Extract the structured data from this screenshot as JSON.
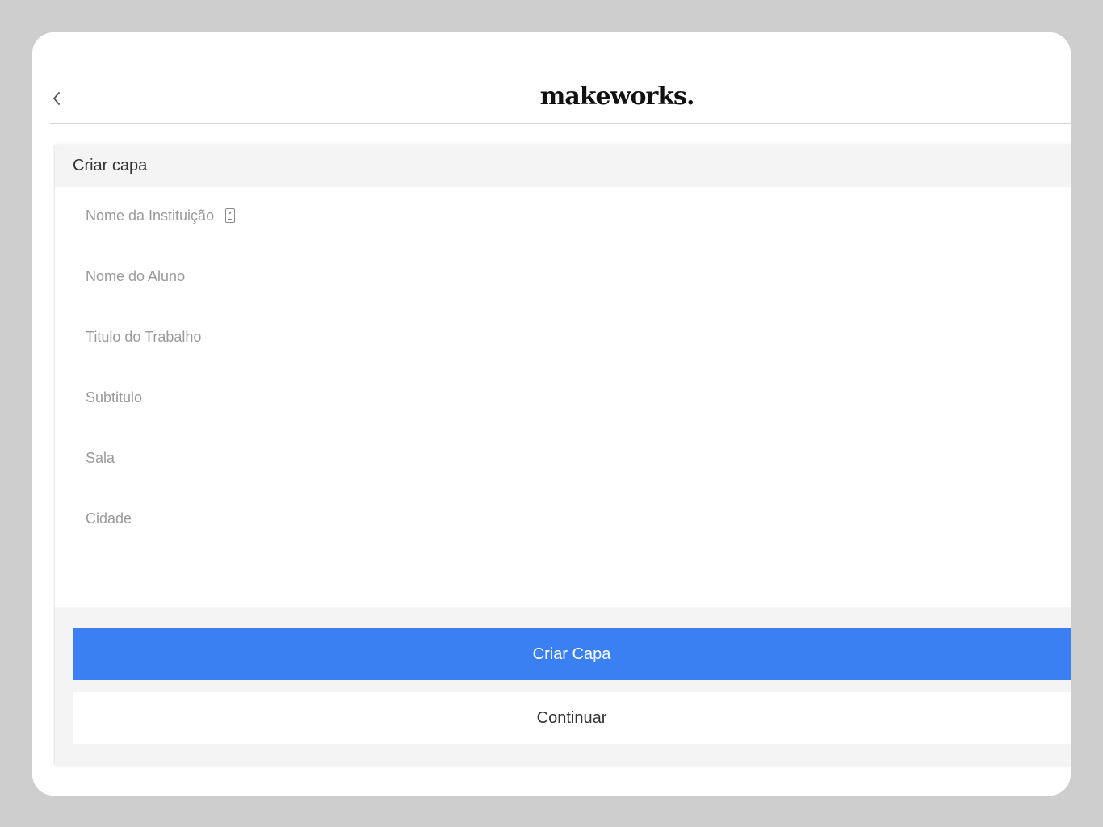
{
  "header": {
    "back_icon": "chevron-left-icon",
    "logo_text": "makeworks."
  },
  "form": {
    "title": "Criar capa",
    "fields": [
      {
        "label": "Nome da Instituição",
        "icon": "contact-card-icon"
      },
      {
        "label": "Nome do Aluno"
      },
      {
        "label": "Titulo do Trabalho"
      },
      {
        "label": "Subtitulo"
      },
      {
        "label": "Sala"
      },
      {
        "label": "Cidade"
      }
    ]
  },
  "actions": {
    "primary_label": "Criar Capa",
    "secondary_label": "Continuar"
  },
  "colors": {
    "primary": "#3a80f3",
    "background": "#cecece"
  }
}
